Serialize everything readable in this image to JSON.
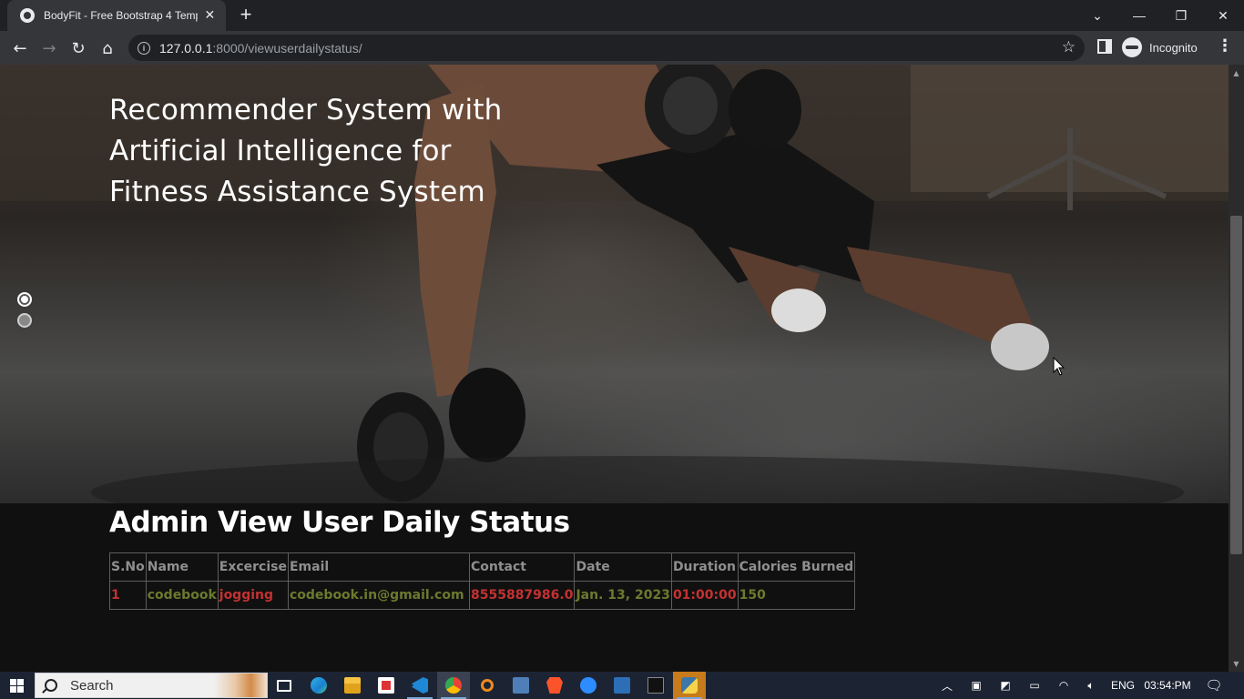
{
  "browser": {
    "tab_title": "BodyFit - Free Bootstrap 4 Templ",
    "new_tab_label": "+",
    "url_host": "127.0.0.1",
    "url_path": ":8000/viewuserdailystatus/",
    "profile_label": "Incognito"
  },
  "hero": {
    "title": "Recommender System with Artificial Intelligence for Fitness Assistance System"
  },
  "page": {
    "heading": "Admin View User Daily Status"
  },
  "table": {
    "headers": [
      "S.No",
      "Name",
      "Excercise",
      "Email",
      "Contact",
      "Date",
      "Duration",
      "Calories Burned"
    ],
    "rows": [
      {
        "sno": "1",
        "name": "codebook",
        "exercise": "jogging",
        "email": "codebook.in@gmail.com",
        "contact": "8555887986.0",
        "date": "Jan. 13, 2023",
        "duration": "01:00:00",
        "calories": "150"
      }
    ]
  },
  "taskbar": {
    "search_placeholder": "Search",
    "language": "ENG",
    "time": "03:54:PM"
  },
  "colors": {
    "red_text": "#c43131",
    "green_text": "#6b7a2e",
    "header_text": "#8f8f8f"
  }
}
